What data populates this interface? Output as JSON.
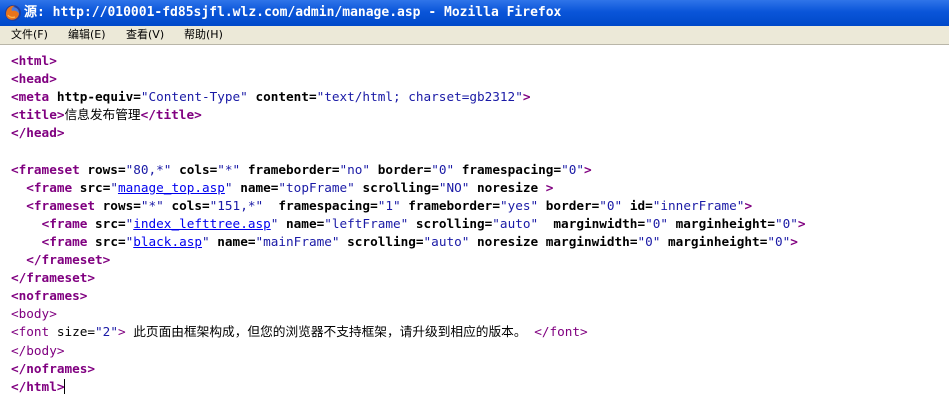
{
  "window": {
    "title": "源: http://010001-fd85sjfl.wlz.com/admin/manage.asp - Mozilla Firefox"
  },
  "menu": {
    "items": [
      {
        "name": "menu-file",
        "label": "文件(F)"
      },
      {
        "name": "menu-edit",
        "label": "编辑(E)"
      },
      {
        "name": "menu-view",
        "label": "查看(V)"
      },
      {
        "name": "menu-help",
        "label": "帮助(H)"
      }
    ]
  },
  "source": {
    "lines": [
      "<html>",
      "<head>",
      "<meta http-equiv=\"Content-Type\" content=\"text/html; charset=gb2312\">",
      "<title>信息发布管理</title>",
      "</head>",
      "",
      "<frameset rows=\"80,*\" cols=\"*\" frameborder=\"no\" border=\"0\" framespacing=\"0\">",
      "  <frame src=\"manage_top.asp\" name=\"topFrame\" scrolling=\"NO\" noresize >",
      "  <frameset rows=\"*\" cols=\"151,*\"  framespacing=\"1\" frameborder=\"yes\" border=\"0\" id=\"innerFrame\">",
      "    <frame src=\"index_lefttree.asp\" name=\"leftFrame\" scrolling=\"auto\"  marginwidth=\"0\" marginheight=\"0\">",
      "    <frame src=\"black.asp\" name=\"mainFrame\" scrolling=\"auto\" noresize marginwidth=\"0\" marginheight=\"0\">",
      "  </frameset>",
      "</frameset>",
      "<noframes>",
      "<body>",
      "<font size=\"2\"> 此页面由框架构成，但您的浏览器不支持框架，请升级到相应的版本。 </font>",
      "</body>",
      "</noframes>",
      "</html>"
    ],
    "links": [
      "manage_top.asp",
      "index_lefttree.asp",
      "black.asp"
    ]
  },
  "colors": {
    "titlebar": "#0a55d9",
    "menubar": "#ece9d8",
    "tag": "#800080",
    "attribute_value": "#1a1aa6",
    "link": "#0000ee"
  },
  "icons": {
    "window": "firefox-logo-icon"
  }
}
